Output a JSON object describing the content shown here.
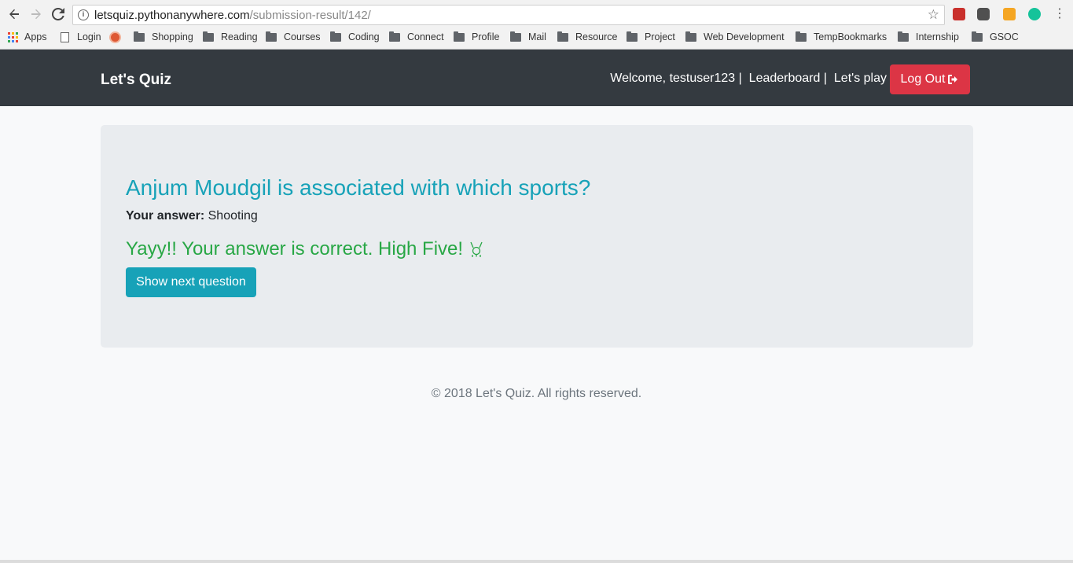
{
  "browser": {
    "url_host": "letsquiz.pythonanywhere.com",
    "url_path": "/submission-result/142/",
    "icons": {
      "back": "arrow-left-icon",
      "forward": "arrow-right-icon",
      "reload": "reload-icon",
      "info": "info-icon",
      "star": "star-icon"
    },
    "bookmarks": [
      {
        "label": "Apps",
        "icon": "apps-grid-icon"
      },
      {
        "label": "Login",
        "icon": "page-icon"
      },
      {
        "label": "",
        "icon": "duckduckgo-icon"
      },
      {
        "label": "Shopping",
        "icon": "folder-icon"
      },
      {
        "label": "Reading",
        "icon": "folder-icon"
      },
      {
        "label": "Courses",
        "icon": "folder-icon"
      },
      {
        "label": "Coding",
        "icon": "folder-icon"
      },
      {
        "label": "Connect",
        "icon": "folder-icon"
      },
      {
        "label": "Profile",
        "icon": "folder-icon"
      },
      {
        "label": "Mail",
        "icon": "folder-icon"
      },
      {
        "label": "Resource",
        "icon": "folder-icon"
      },
      {
        "label": "Project",
        "icon": "folder-icon"
      },
      {
        "label": "Web Development",
        "icon": "folder-icon"
      },
      {
        "label": "TempBookmarks",
        "icon": "folder-icon"
      },
      {
        "label": "Internship",
        "icon": "folder-icon"
      },
      {
        "label": "GSOC",
        "icon": "folder-icon"
      }
    ]
  },
  "navbar": {
    "brand": "Let's Quiz",
    "welcome": "Welcome, testuser123 |",
    "leaderboard": "Leaderboard |",
    "lets_play": "Let's play",
    "logout": "Log Out",
    "logout_icon": "sign-out-icon"
  },
  "result": {
    "question": "Anjum Moudgil is associated with which sports?",
    "answer_label": "Your answer:",
    "answer_value": "Shooting",
    "message": "Yayy!! Your answer is correct. High Five!",
    "message_icon": "high-five-icon",
    "next_button": "Show next question"
  },
  "footer": {
    "text": "© 2018 Let's Quiz.  All rights reserved."
  },
  "colors": {
    "navbar_bg": "#343a40",
    "danger": "#dc3545",
    "info": "#17a2b8",
    "success": "#28a745",
    "card_bg": "#e9ecef",
    "page_bg": "#f8f9fa"
  }
}
